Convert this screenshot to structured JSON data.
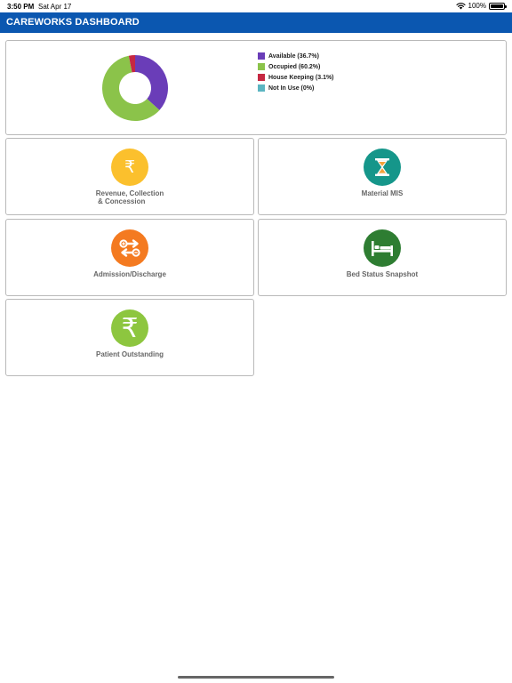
{
  "status_bar": {
    "time": "3:50 PM",
    "date": "Sat Apr 17",
    "battery": "100%",
    "battery_level": 1.0
  },
  "header": {
    "title": "CAREWORKS DASHBOARD"
  },
  "chart_data": {
    "type": "pie",
    "donut": true,
    "categories": [
      "Available",
      "Occupied",
      "House Keeping",
      "Not In Use"
    ],
    "values": [
      36.7,
      60.2,
      3.1,
      0
    ],
    "colors": [
      "#6a3db8",
      "#8bc34a",
      "#c62842",
      "#5bb5c2"
    ],
    "legend": [
      "Available (36.7%)",
      "Occupied (60.2%)",
      "House Keeping (3.1%)",
      "Not In Use (0%)"
    ],
    "legend_position": "right"
  },
  "tiles": {
    "revenue": {
      "line1": "Revenue, Collection",
      "line2": "& Concession",
      "icon": "rupee-icon",
      "color": "#fbc02d"
    },
    "material": {
      "label": "Material MIS",
      "icon": "hourglass-icon",
      "color": "#15968a"
    },
    "admission": {
      "label": "Admission/Discharge",
      "icon": "admission-discharge-icon",
      "color": "#f47a20"
    },
    "bed_status": {
      "label": "Bed Status Snapshot",
      "icon": "bed-icon",
      "color": "#2e7d32"
    },
    "patient_outstanding": {
      "label": "Patient Outstanding",
      "icon": "rupee-icon",
      "color": "#8dc63f"
    }
  }
}
